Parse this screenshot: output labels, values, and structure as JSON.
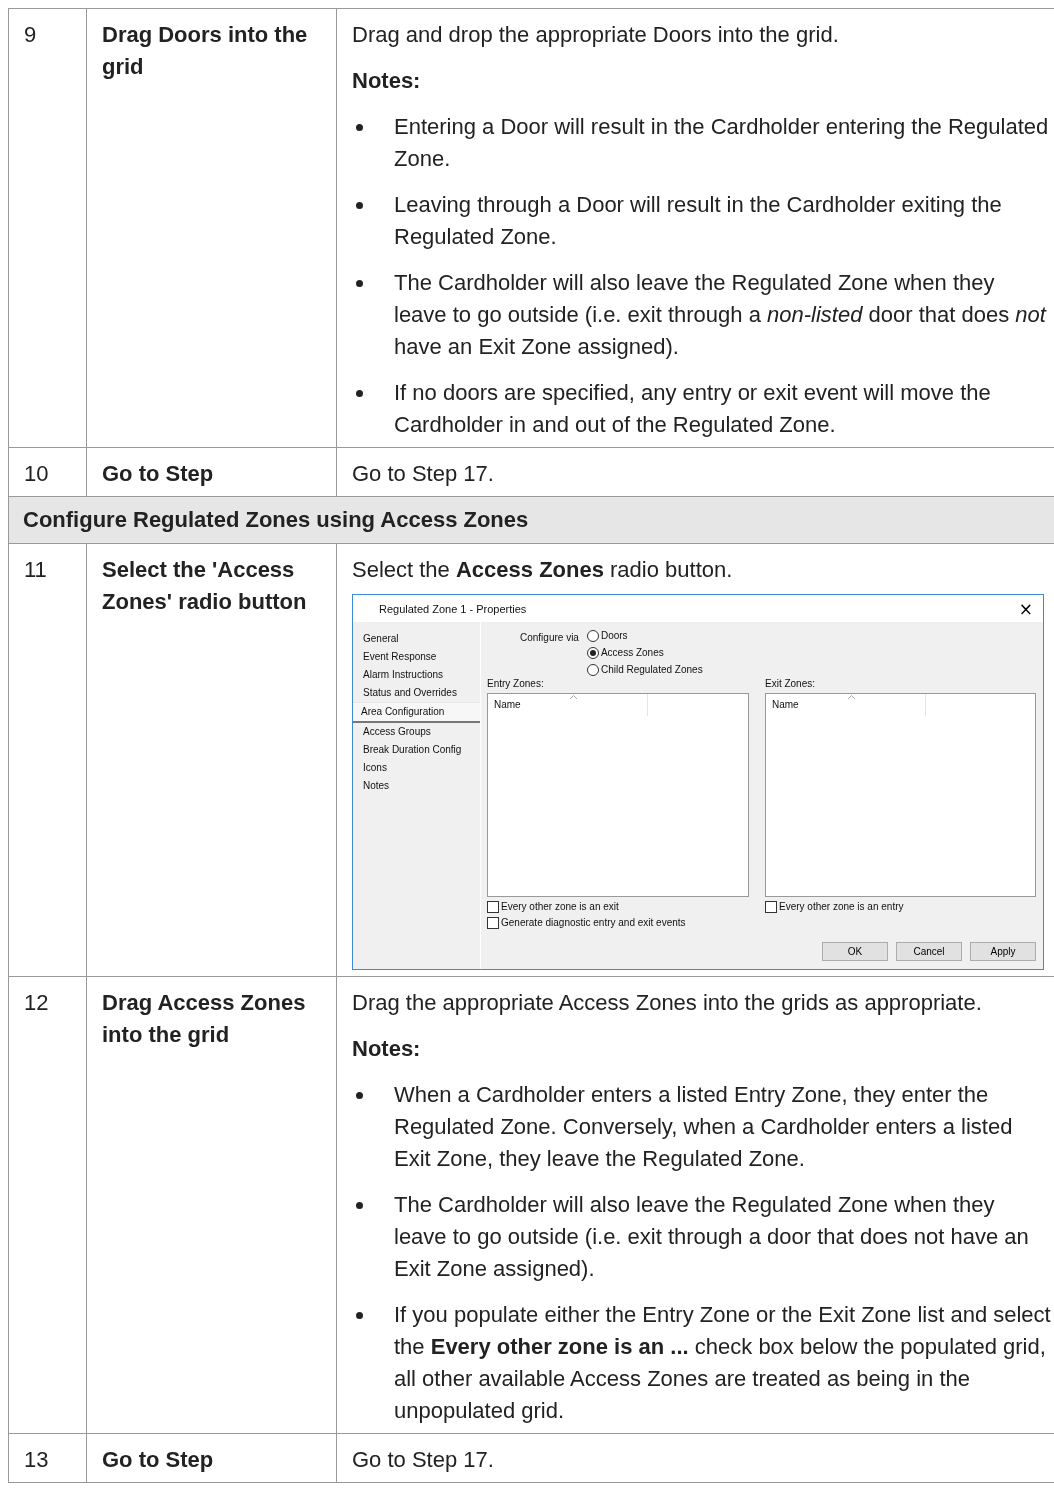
{
  "rows": [
    {
      "kind": "step",
      "number": "9",
      "action": "Drag Doors into the grid",
      "content": [
        {
          "kind": "para",
          "text": "Drag and drop the appropriate Doors into the grid."
        },
        {
          "kind": "notes",
          "text": "Notes:"
        },
        {
          "kind": "bullet",
          "text": "Entering a Door will result in the Cardholder entering the Regulated Zone."
        },
        {
          "kind": "bullet",
          "text": "Leaving through a Door will result in the Cardholder exiting the Regulated Zone."
        },
        {
          "kind": "bullet",
          "text": "The Cardholder will also leave the Regulated Zone when they leave to go outside (i.e. exit through a *non-listed* door that does *not* have an Exit Zone assigned)."
        },
        {
          "kind": "bullet",
          "text": "If no doors are specified, any entry or exit event will move the Cardholder in and out of the Regulated Zone."
        }
      ]
    },
    {
      "kind": "step",
      "number": "10",
      "action": "Go to Step",
      "content": [
        {
          "kind": "para",
          "text": "Go to Step 17."
        }
      ]
    },
    {
      "kind": "section",
      "title": "Configure Regulated Zones using Access Zones"
    },
    {
      "kind": "step",
      "number": "11",
      "action": "Select the 'Access Zones' radio button",
      "content": [
        {
          "kind": "para",
          "text": "Select the **Access Zones** radio button."
        },
        {
          "kind": "dialog",
          "title": "Regulated Zone 1 - Properties",
          "close": "×",
          "nav": [
            {
              "label": "General",
              "selected": false
            },
            {
              "label": "Event Response",
              "selected": false
            },
            {
              "label": "Alarm Instructions",
              "selected": false
            },
            {
              "label": "Status and Overrides",
              "selected": false
            },
            {
              "label": "Area Configuration",
              "selected": true
            },
            {
              "label": "Access Groups",
              "selected": false
            },
            {
              "label": "Break Duration Config",
              "selected": false
            },
            {
              "label": "Icons",
              "selected": false
            },
            {
              "label": "Notes",
              "selected": false
            }
          ],
          "configure_label": "Configure via",
          "radios": [
            {
              "label": "Doors",
              "selected": false
            },
            {
              "label": "Access Zones",
              "selected": true
            },
            {
              "label": "Child Regulated Zones",
              "selected": false
            }
          ],
          "panels": [
            {
              "label": "Entry Zones:",
              "column": "Name",
              "checkboxes": [
                {
                  "label": "Every other zone is an exit",
                  "checked": false
                },
                {
                  "label": "Generate diagnostic entry and exit events",
                  "checked": false
                }
              ]
            },
            {
              "label": "Exit Zones:",
              "column": "Name",
              "checkboxes": [
                {
                  "label": "Every other zone is an entry",
                  "checked": false
                }
              ]
            }
          ],
          "buttons": [
            "OK",
            "Cancel",
            "Apply"
          ]
        }
      ]
    },
    {
      "kind": "step",
      "number": "12",
      "action": "Drag Access Zones into the grid",
      "content": [
        {
          "kind": "para",
          "text": "Drag the appropriate Access Zones into the grids as appropriate."
        },
        {
          "kind": "notes",
          "text": "Notes:"
        },
        {
          "kind": "bullet",
          "text": "When a Cardholder enters a listed Entry Zone, they enter the Regulated Zone. Conversely, when a Cardholder enters a listed Exit Zone, they leave the Regulated Zone."
        },
        {
          "kind": "bullet",
          "text": "The Cardholder will also leave the Regulated Zone when they leave to go outside (i.e. exit through a door that does not have an Exit Zone assigned)."
        },
        {
          "kind": "bullet",
          "text": "If you populate either the Entry Zone or the Exit Zone list and select the **Every other zone is an ...** check box below the populated grid, all other available Access Zones are treated as being in the unpopulated grid."
        }
      ]
    },
    {
      "kind": "step",
      "number": "13",
      "action": "Go to Step",
      "content": [
        {
          "kind": "para",
          "text": "Go to Step 17."
        }
      ]
    }
  ]
}
